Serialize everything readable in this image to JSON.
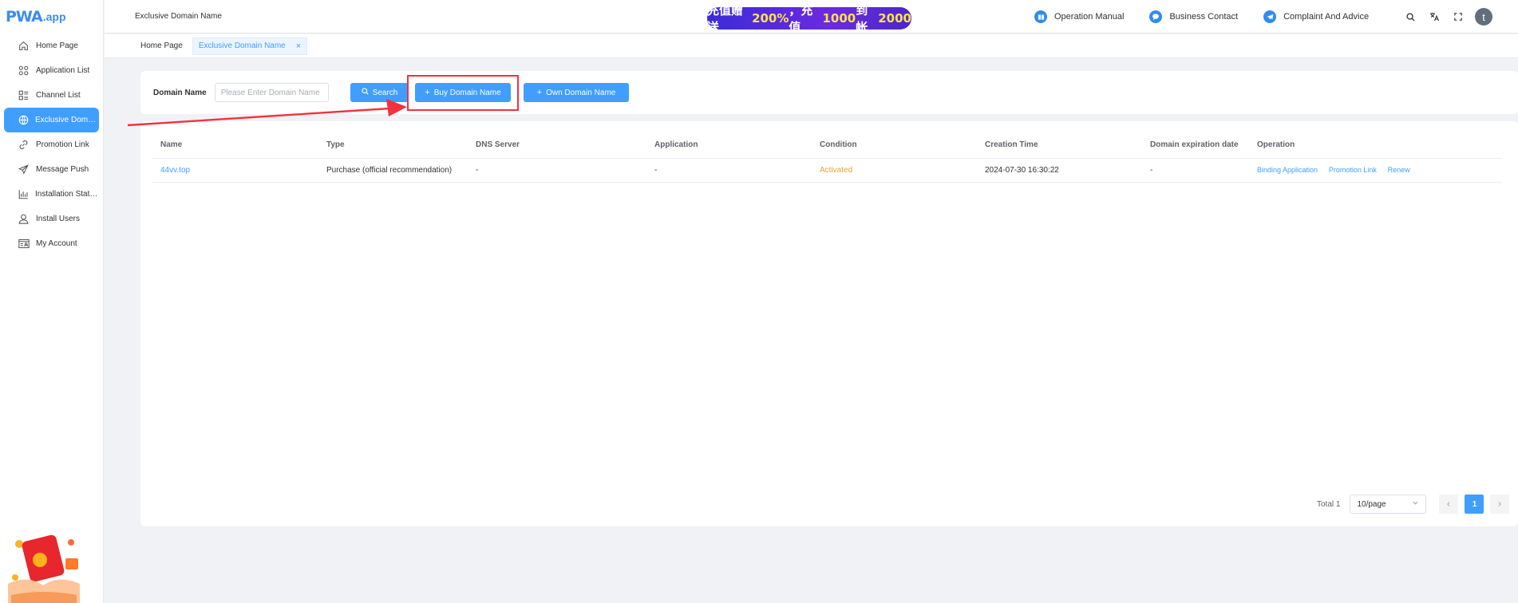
{
  "app": {
    "logo_mark": "PWA",
    "logo_domain": ".app"
  },
  "sidebar": {
    "items": [
      {
        "label": "Home Page",
        "icon": "home-icon"
      },
      {
        "label": "Application List",
        "icon": "grid-icon"
      },
      {
        "label": "Channel List",
        "icon": "list-icon"
      },
      {
        "label": "Exclusive Domain...",
        "icon": "globe-icon",
        "active": true
      },
      {
        "label": "Promotion Link",
        "icon": "link-icon"
      },
      {
        "label": "Message Push",
        "icon": "send-icon"
      },
      {
        "label": "Installation Statist...",
        "icon": "chart-icon"
      },
      {
        "label": "Install Users",
        "icon": "user-icon"
      },
      {
        "label": "My Account",
        "icon": "account-card-icon"
      }
    ]
  },
  "header": {
    "title": "Exclusive Domain Name",
    "banner": {
      "part1": "充值赠送",
      "pct": "200%",
      "part2": "，充值",
      "amount1": "1000",
      "part3": "到帐",
      "amount2": "2000"
    },
    "links": [
      {
        "label": "Operation Manual",
        "icon": "book-icon"
      },
      {
        "label": "Business Contact",
        "icon": "chat-icon"
      },
      {
        "label": "Complaint And Advice",
        "icon": "telegram-icon"
      }
    ],
    "avatar_letter": "t"
  },
  "tabs": [
    {
      "label": "Home Page"
    },
    {
      "label": "Exclusive Domain Name",
      "active": true
    }
  ],
  "search": {
    "label": "Domain Name",
    "placeholder": "Please Enter Domain Name",
    "search_btn": "Search",
    "buy_btn": "Buy Domain Name",
    "own_btn": "Own Domain Name"
  },
  "table": {
    "columns": [
      "Name",
      "Type",
      "DNS Server",
      "Application",
      "Condition",
      "Creation Time",
      "Domain expiration date",
      "Operation"
    ],
    "rows": [
      {
        "name": "44vv.top",
        "type": "Purchase (official recommendation)",
        "dns": "-",
        "application": "-",
        "condition": "Activated",
        "created": "2024-07-30 16:30:22",
        "expires": "-",
        "ops": [
          "Binding Application",
          "Promotion Link",
          "Renew"
        ]
      }
    ]
  },
  "pager": {
    "total": "Total 1",
    "size": "10/page",
    "page": "1"
  },
  "colors": {
    "primary": "#409eff",
    "warning": "#e6a23c",
    "annotation": "#f5313f"
  }
}
